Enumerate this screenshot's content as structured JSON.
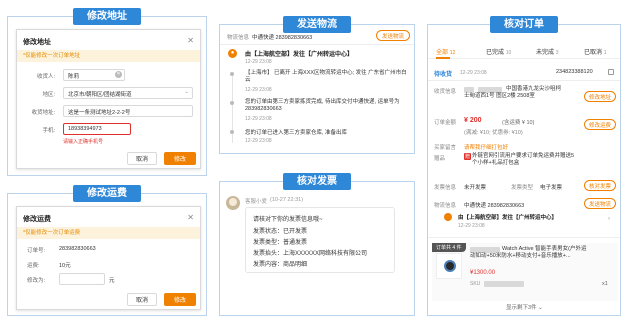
{
  "modify_address": {
    "header": "修改地址",
    "dialog_title": "修改地址",
    "notice": "*仅能修改一次订单地址",
    "name_label": "收货人:",
    "name_value": "陈莉",
    "region_label": "地区:",
    "region_value": "北京市/朝阳区/团结湖街道",
    "detail_label": "收货地址:",
    "detail_value": "这是一条测试地址2-2-2号",
    "phone_label": "手机:",
    "phone_value": "18938394973",
    "error_text": "请输入正确手机号",
    "cancel": "取消",
    "ok": "修改"
  },
  "modify_freight": {
    "header": "修改运费",
    "dialog_title": "修改运费",
    "notice": "*仅能修改一次订单运费",
    "order_no_label": "订单号:",
    "order_no": "283982830663",
    "orig_label": "运费:",
    "orig_value": "10元",
    "new_label": "修改为:",
    "unit": "元",
    "cancel": "取消",
    "ok": "修改"
  },
  "send_logistics": {
    "header": "发送物流",
    "info_label": "物流信息",
    "carrier": "中通快递 283982830663",
    "send_button": "发送物流",
    "route_title": "由【上海航空部】发往【广州转运中心】",
    "route_time": "12-29 23:08",
    "events": [
      {
        "text": "【上海市】 已离开 上海XXX区物流转运中心; 发往 广东省广州市白云",
        "time": "12-29 23:08"
      },
      {
        "text": "您的订单由第三方卖家拣货完成, 待出库交付中通快递, 运单号为 283982830663",
        "time": "12-29 23:08"
      },
      {
        "text": "您的订单已进入第三方卖家仓库, 准备出库",
        "time": "12-29 23:08"
      }
    ]
  },
  "verify_invoice": {
    "header": "核对发票",
    "sender": "客服小爱",
    "time": "(10-27 22:31)",
    "intro": "请核对下你的发票信息哦~",
    "lines": [
      "发票状态：已开发票",
      "发票类型：普通发票",
      "发票抬头：上海XXXXXX网络科技有限公司",
      "发票内容：商品明细"
    ]
  },
  "verify_order": {
    "header": "核对订单",
    "tabs": [
      {
        "label": "全部",
        "count": "12"
      },
      {
        "label": "已完成",
        "count": "10"
      },
      {
        "label": "未完成",
        "count": "3"
      },
      {
        "label": "已取消",
        "count": "1"
      }
    ],
    "status": "待收货",
    "time": "12-29 23:08",
    "order_no": "234823388120",
    "address_label": "收货信息",
    "address_value": "中国香港九龙尖沙咀柯士甸道西1号 图区2楼 2508室",
    "modify_address_btn": "修改地址",
    "amount_label": "订单金额",
    "amount_value": "¥ 200",
    "amount_detail": "(含运费 ¥ 10)",
    "amount_sub": "(满减: ¥10; 优惠券: ¥10)",
    "modify_freight_btn": "修改运费",
    "remark_label": "买家留言",
    "remark_value": "请帮我仔细打包好",
    "gift_label": "赠品",
    "gift_badge": "赠",
    "gift_value": "外链官网引流用户要求订单免运费并赠送5个小样+礼品打包盒",
    "invoice_label": "发票信息",
    "invoice_status": "未开发票",
    "invoice_type_label": "发票类型",
    "invoice_type_value": "电子发票",
    "verify_invoice_btn": "核对发票",
    "logistics_label": "物流信息",
    "logistics_value": "中通快递 283982830663",
    "send_logistics_btn": "发送物流",
    "route_title": "由【上海航空部】发往【广州转运中心】",
    "route_time": "12-29 23:08",
    "product_badge": "订单共 4 件",
    "product_name": "Watch Active 智能手表男女(户外运动如动+50米防水+移动支付+音乐播放+...",
    "product_price": "¥1300.00",
    "sku_label": "SKU",
    "product_qty": "x1",
    "more_items": "显示剩下3件 ⌄"
  }
}
